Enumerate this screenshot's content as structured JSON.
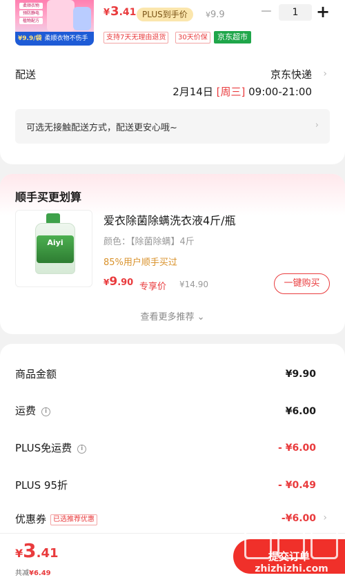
{
  "product": {
    "thumb_tags": [
      "柔顺衣物",
      "预防静电",
      "植物配方"
    ],
    "thumb_banner_price": "¥9.9/袋",
    "thumb_banner_text": "柔顺衣物不伤手",
    "price_symbol": "¥",
    "price_int": "3",
    "price_dec": ".41",
    "plus_badge": "PLUS到手价",
    "orig_price_symbol": "¥",
    "orig_price": "9.9",
    "quantity": "1",
    "minus_glyph": "−",
    "plus_glyph": "+",
    "service_tags": [
      "支持7天无理由退货",
      "30天价保"
    ],
    "jd_market_tag": "京东超市"
  },
  "delivery": {
    "label": "配送",
    "carrier": "京东快递",
    "date": "2月14日",
    "weekday": "[周三]",
    "time": "09:00-21:00",
    "notice": "可选无接触配送方式，配送更安心哦~"
  },
  "recommend": {
    "title": "顺手买更划算",
    "image_label": "Aiyi",
    "product_name": "爱衣除菌除螨洗衣液4斤/瓶",
    "spec": "颜色：【除菌除螨】4斤",
    "rate": "85%用户顺手买过",
    "price_symbol": "¥",
    "price_int": "9",
    "price_dec": ".90",
    "exclusive_label": "专享价",
    "orig_price": "¥14.90",
    "buy_button": "一键购买",
    "more": "查看更多推荐 ⌄"
  },
  "costs": [
    {
      "label": "商品金额",
      "value": "¥9.90",
      "info": false,
      "red": false
    },
    {
      "label": "运费",
      "value": "¥6.00",
      "info": true,
      "red": false
    },
    {
      "label": "PLUS免运费",
      "value": "- ¥6.00",
      "info": true,
      "red": true
    },
    {
      "label": "PLUS 95折",
      "value": "- ¥0.49",
      "info": false,
      "red": true
    },
    {
      "label": "优惠券",
      "value": "-¥6.00",
      "info": false,
      "red": true,
      "tag": "已选推荐优惠"
    }
  ],
  "bottom": {
    "price_symbol": "¥",
    "price_int": "3",
    "price_dec": ".41",
    "save_prefix": "共减",
    "save_amount": "¥6.49",
    "submit": "提交订单"
  },
  "watermark": {
    "text": "zhizhizhi.com"
  },
  "colors": {
    "accent_red": "#e93b3d",
    "plus_gold": "#fbe6ad",
    "jd_green": "#1fa64a",
    "submit_red": "#f0302a"
  },
  "icons": [
    "chevron-right-icon",
    "info-icon",
    "chevron-down-icon",
    "minus-icon",
    "plus-icon"
  ]
}
